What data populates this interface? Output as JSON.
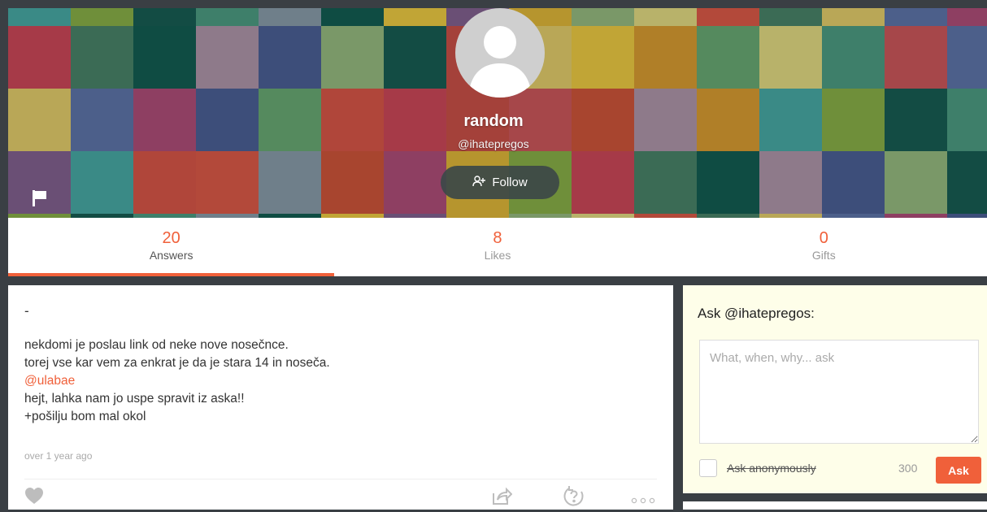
{
  "profile": {
    "display_name": "random",
    "username": "@ihatepregos",
    "follow_label": "Follow"
  },
  "stats": [
    {
      "count": "20",
      "label": "Answers",
      "active": true
    },
    {
      "count": "8",
      "label": "Likes",
      "active": false
    },
    {
      "count": "0",
      "label": "Gifts",
      "active": false
    }
  ],
  "post": {
    "question": "-",
    "lines": [
      "nekdomi je poslau link od neke nove nosečnce.",
      "torej vse kar vem za enkrat je da je stara 14 in noseča."
    ],
    "mention": "@ulabae",
    "lines_after": [
      "hejt, lahka nam jo uspe spravit iz aska!!",
      "+pošilju bom mal okol"
    ],
    "timestamp": "over 1 year ago"
  },
  "ask": {
    "title": "Ask @ihatepregos:",
    "placeholder": "What, when, why... ask",
    "anonymous_label": "Ask anonymously",
    "char_count": "300",
    "button_label": "Ask"
  },
  "icons": {
    "flag": "flag-icon",
    "follow": "add-user-icon",
    "like": "heart-icon",
    "share": "share-icon",
    "ask_again": "ask-again-icon",
    "more": "more-dots-icon"
  },
  "colors": {
    "accent": "#f0603a",
    "ask_box_bg": "#fefee9",
    "page_bg": "#3a3f44",
    "cover_palette": [
      "#3a8a86",
      "#558a5e",
      "#7a9868",
      "#6f8f3a",
      "#b0463a",
      "#b8b26a",
      "#134c44",
      "#a63a48",
      "#b3493a",
      "#3e7f6a",
      "#a4413a",
      "#3b6b55",
      "#6f7f8a",
      "#a6474a",
      "#b9a757",
      "#0f4c43",
      "#a8452f",
      "#4c5f8a",
      "#c1a536",
      "#8e7a8a",
      "#8e3f62",
      "#6a4f75",
      "#b07f28",
      "#3d4e7a",
      "#b6952e"
    ]
  }
}
